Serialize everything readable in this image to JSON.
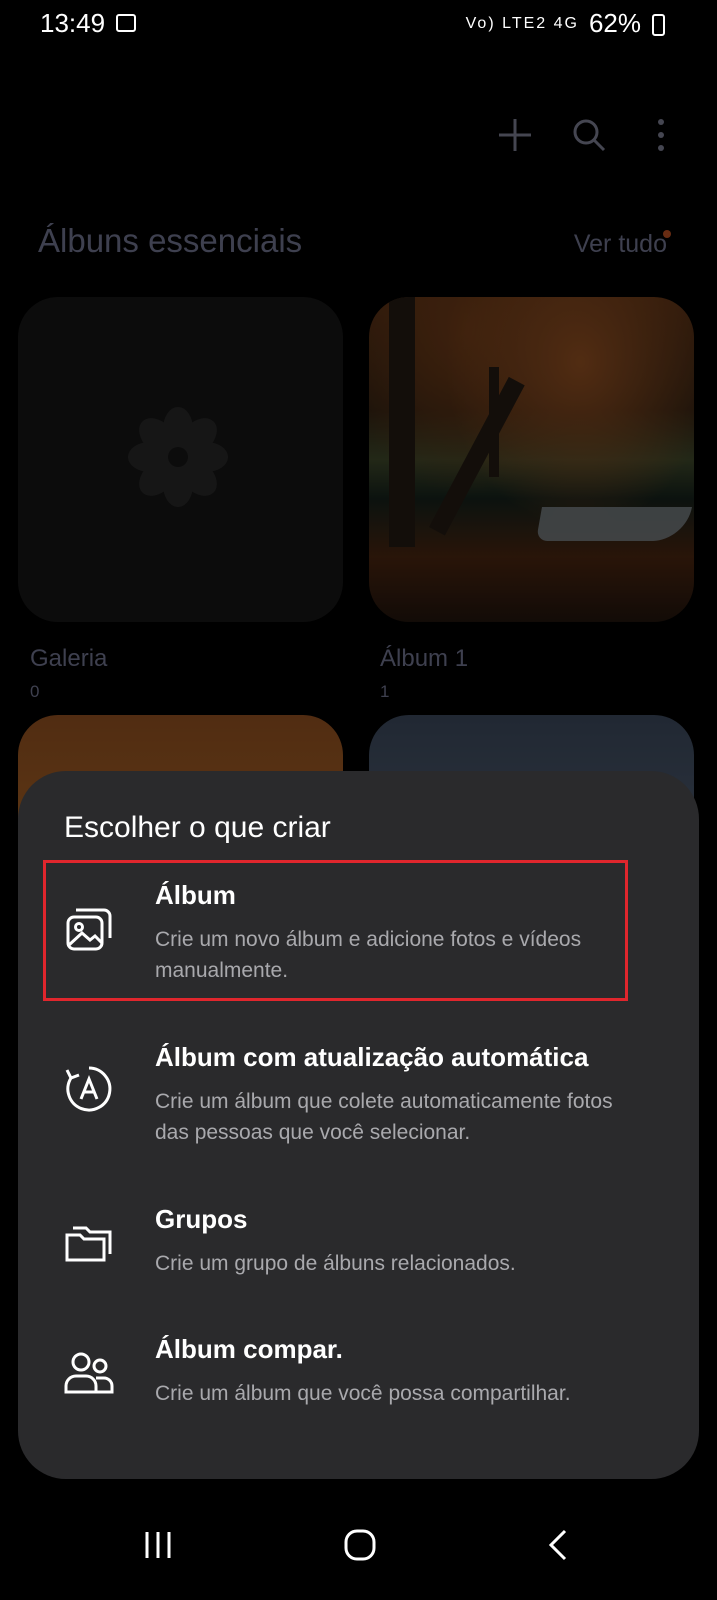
{
  "status_bar": {
    "time": "13:49",
    "network": "Vo) LTE2 4G",
    "battery": "62%"
  },
  "toolbar": {
    "add_icon": "plus-icon",
    "search_icon": "search-icon",
    "more_icon": "more-vertical-icon"
  },
  "section": {
    "title": "Álbuns essenciais",
    "see_all": "Ver tudo"
  },
  "albums": [
    {
      "name": "Galeria",
      "count": "0"
    },
    {
      "name": "Álbum 1",
      "count": "1"
    }
  ],
  "sheet": {
    "title": "Escolher o que criar",
    "options": [
      {
        "title": "Álbum",
        "desc": "Crie um novo álbum e adicione fotos e vídeos manualmente.",
        "icon": "album-icon"
      },
      {
        "title": "Álbum com atualização automática",
        "desc": "Crie um álbum que colete automaticamente fotos das pessoas que você selecionar.",
        "icon": "auto-update-icon"
      },
      {
        "title": "Grupos",
        "desc": "Crie um grupo de álbuns relacionados.",
        "icon": "folders-icon"
      },
      {
        "title": "Álbum compar.",
        "desc": "Crie um álbum que você possa compartilhar.",
        "icon": "people-icon"
      }
    ]
  },
  "nav": {
    "recents": "recents-icon",
    "home": "home-icon",
    "back": "back-icon"
  },
  "colors": {
    "background": "#000000",
    "sheet": "#2a2a2c",
    "muted_text": "#8c8fb0",
    "highlight": "#e0262d",
    "notification_dot": "#e8622c"
  }
}
